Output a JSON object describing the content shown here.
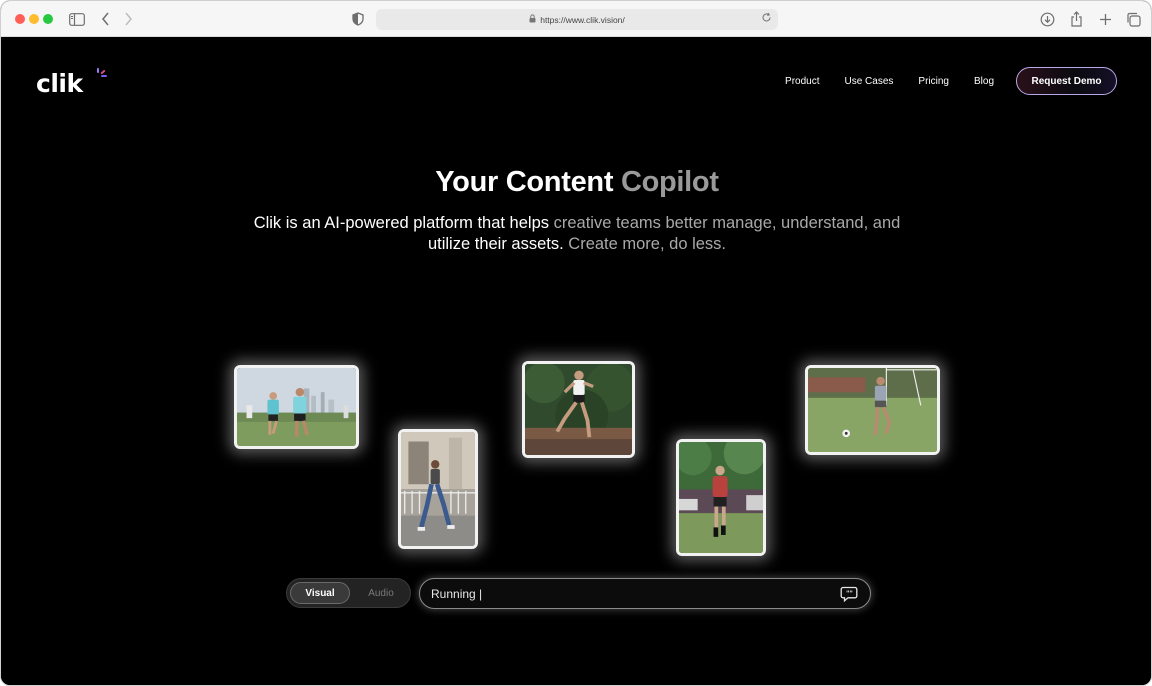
{
  "browser": {
    "url": "https://www.clik.vision/"
  },
  "header": {
    "logo_text": "clik",
    "nav": [
      {
        "label": "Product"
      },
      {
        "label": "Use Cases"
      },
      {
        "label": "Pricing"
      },
      {
        "label": "Blog"
      }
    ],
    "cta_label": "Request Demo"
  },
  "hero": {
    "title_part1": "Your Content ",
    "title_part2": "Copilot",
    "subtitle_part1": "Clik is an AI-powered platform that helps ",
    "subtitle_part2": "creative teams better manage, understand, and",
    "subtitle_part3": "utilize their assets. ",
    "subtitle_part4": "Create more, do less."
  },
  "search": {
    "mode_visual": "Visual",
    "mode_audio": "Audio",
    "selected_mode": "Visual",
    "query": "Running |"
  },
  "photos": [
    {
      "subject": "two men running on a field with city skyline"
    },
    {
      "subject": "woman running on sidewalk"
    },
    {
      "subject": "man sprinting past bushes"
    },
    {
      "subject": "man in red shirt playing soccer"
    },
    {
      "subject": "woman kicking soccer ball"
    }
  ]
}
